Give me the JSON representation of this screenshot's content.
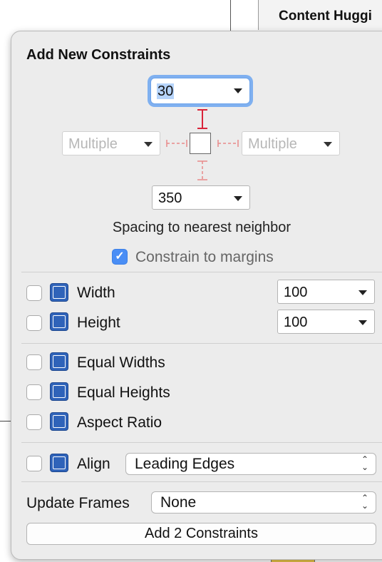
{
  "background": {
    "inspector_header": "Content Huggi"
  },
  "popover": {
    "title": "Add New Constraints",
    "spacing": {
      "top": "30",
      "left": "Multiple",
      "right": "Multiple",
      "bottom": "350"
    },
    "spacing_caption": "Spacing to nearest neighbor",
    "constrain_to_margins": {
      "label": "Constrain to margins",
      "checked": true
    },
    "width": {
      "label": "Width",
      "value": "100",
      "checked": false
    },
    "height": {
      "label": "Height",
      "value": "100",
      "checked": false
    },
    "equal_widths": {
      "label": "Equal Widths",
      "checked": false
    },
    "equal_heights": {
      "label": "Equal Heights",
      "checked": false
    },
    "aspect_ratio": {
      "label": "Aspect Ratio",
      "checked": false
    },
    "align": {
      "label": "Align",
      "value": "Leading Edges",
      "checked": false
    },
    "update_frames": {
      "label": "Update Frames",
      "value": "None"
    },
    "add_button": "Add 2 Constraints"
  },
  "colors": {
    "accent": "#4a8ef5",
    "icon_blue": "#2f63b9",
    "pin_solid": "#d9243a",
    "pin_dashed": "#e88a8a"
  }
}
